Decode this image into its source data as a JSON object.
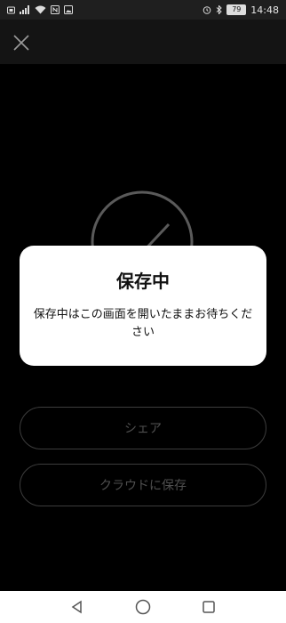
{
  "status_bar": {
    "time": "14:48",
    "battery_level": "79",
    "icons_left": [
      "sim-icon",
      "signal-icon",
      "wifi-icon",
      "nfc-icon",
      "photo-icon"
    ],
    "icons_right": [
      "alarm-icon",
      "bluetooth-icon"
    ]
  },
  "top_bar": {
    "close_icon": "close-icon"
  },
  "buttons": {
    "share": "シェア",
    "cloud_save": "クラウドに保存"
  },
  "dialog": {
    "title": "保存中",
    "message": "保存中はこの画面を開いたままお待ちください"
  },
  "nav": {
    "back": "back-icon",
    "home": "home-icon",
    "recents": "recents-icon"
  },
  "colors": {
    "background": "#000000",
    "dialog": "#ffffff",
    "button_border": "#3d3d3d",
    "button_text": "#4f4f4f"
  }
}
